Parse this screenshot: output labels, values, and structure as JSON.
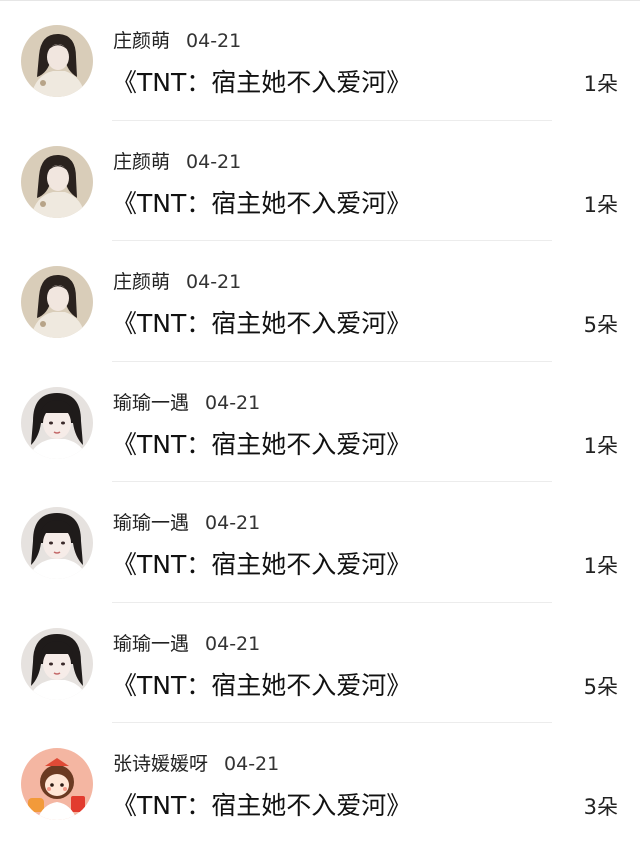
{
  "items": [
    {
      "user": "庄颜萌",
      "date": "04-21",
      "title": "《TNT：宿主她不入爱河》",
      "count": "1朵",
      "avatar": "user-a"
    },
    {
      "user": "庄颜萌",
      "date": "04-21",
      "title": "《TNT：宿主她不入爱河》",
      "count": "1朵",
      "avatar": "user-a"
    },
    {
      "user": "庄颜萌",
      "date": "04-21",
      "title": "《TNT：宿主她不入爱河》",
      "count": "5朵",
      "avatar": "user-a"
    },
    {
      "user": "瑜瑜一遇",
      "date": "04-21",
      "title": "《TNT：宿主她不入爱河》",
      "count": "1朵",
      "avatar": "user-b"
    },
    {
      "user": "瑜瑜一遇",
      "date": "04-21",
      "title": "《TNT：宿主她不入爱河》",
      "count": "1朵",
      "avatar": "user-b"
    },
    {
      "user": "瑜瑜一遇",
      "date": "04-21",
      "title": "《TNT：宿主她不入爱河》",
      "count": "5朵",
      "avatar": "user-b"
    },
    {
      "user": "张诗媛媛呀",
      "date": "04-21",
      "title": "《TNT：宿主她不入爱河》",
      "count": "3朵",
      "avatar": "user-c"
    }
  ],
  "colors": {
    "text": "#111111",
    "divider": "#ececec",
    "background": "#ffffff"
  }
}
